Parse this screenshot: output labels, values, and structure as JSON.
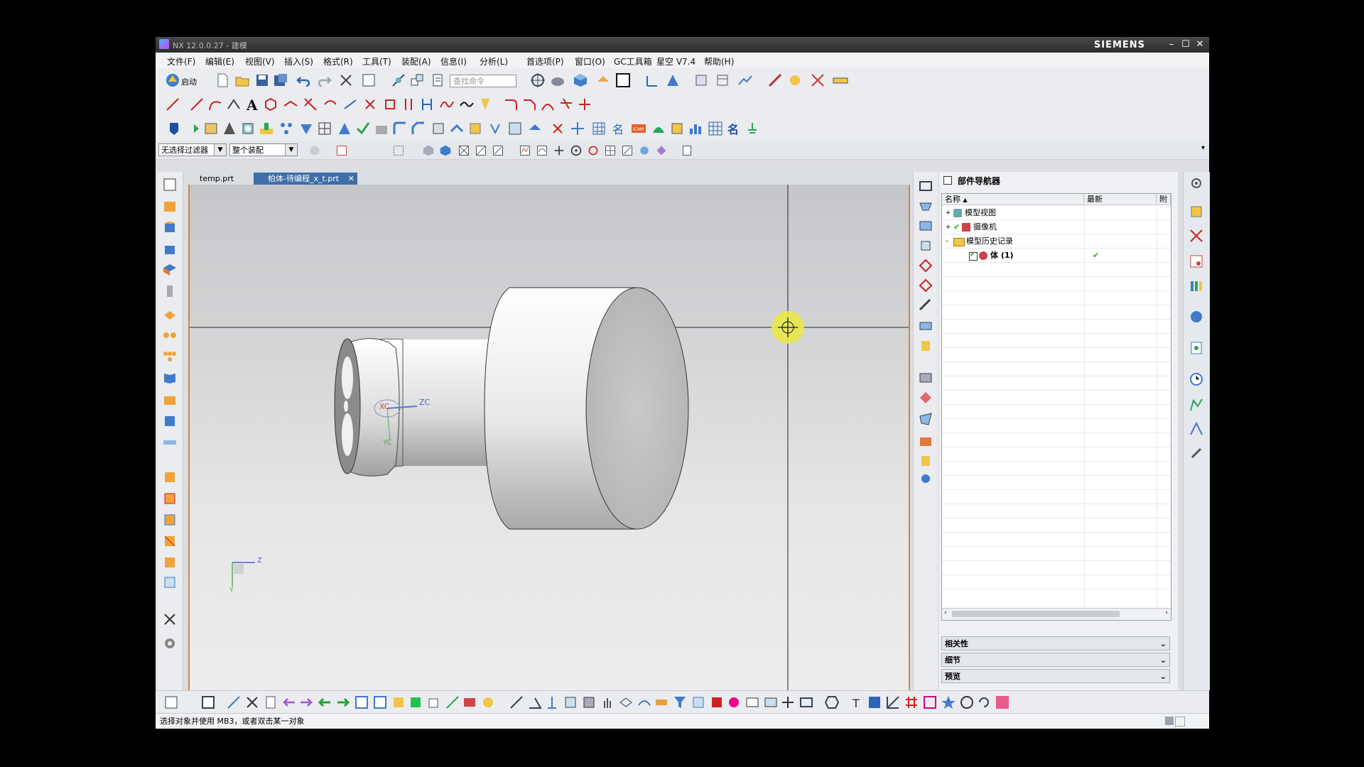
{
  "window": {
    "title": "NX 12.0.0.27 - 建模",
    "brand": "SIEMENS",
    "min": "–",
    "max": "☐",
    "close": "✕"
  },
  "menu": [
    "文件(F)",
    "编辑(E)",
    "视图(V)",
    "插入(S)",
    "格式(R)",
    "工具(T)",
    "装配(A)",
    "信息(I)",
    "分析(L)",
    "首选项(P)",
    "窗口(O)",
    "GC工具箱",
    "星空 V7.4",
    "帮助(H)"
  ],
  "toolbar": {
    "start_label": "启动",
    "search_placeholder": "查找命令"
  },
  "filter": {
    "type_filter": "无选择过滤器",
    "scope": "整个装配"
  },
  "tabs": [
    {
      "label": "temp.prt",
      "active": false
    },
    {
      "label": "柏体-待编程_x_t.prt",
      "active": true
    }
  ],
  "viewport": {
    "wcs": {
      "x": "XC",
      "y": "YC",
      "z": "ZC"
    },
    "triad": {
      "z": "Z",
      "y": "Y"
    }
  },
  "navigator": {
    "title": "部件导航器",
    "columns": {
      "name": "名称",
      "latest": "最新",
      "attached": "附"
    },
    "rows": [
      {
        "label": "模型视图",
        "expand": "+",
        "latest": ""
      },
      {
        "label": "摄像机",
        "expand": "+",
        "latest": ""
      },
      {
        "label": "模型历史记录",
        "expand": "–",
        "latest": ""
      },
      {
        "label": "体 (1)",
        "expand": "",
        "latest": "✔"
      }
    ],
    "sections": [
      "相关性",
      "细节",
      "预览"
    ]
  },
  "status": "选择对象并使用 MB3，或者双击某一对象",
  "colors": {
    "accent_orange": "#c9874a",
    "highlight_yellow": "#e8e84a",
    "check_green": "#22a534"
  }
}
